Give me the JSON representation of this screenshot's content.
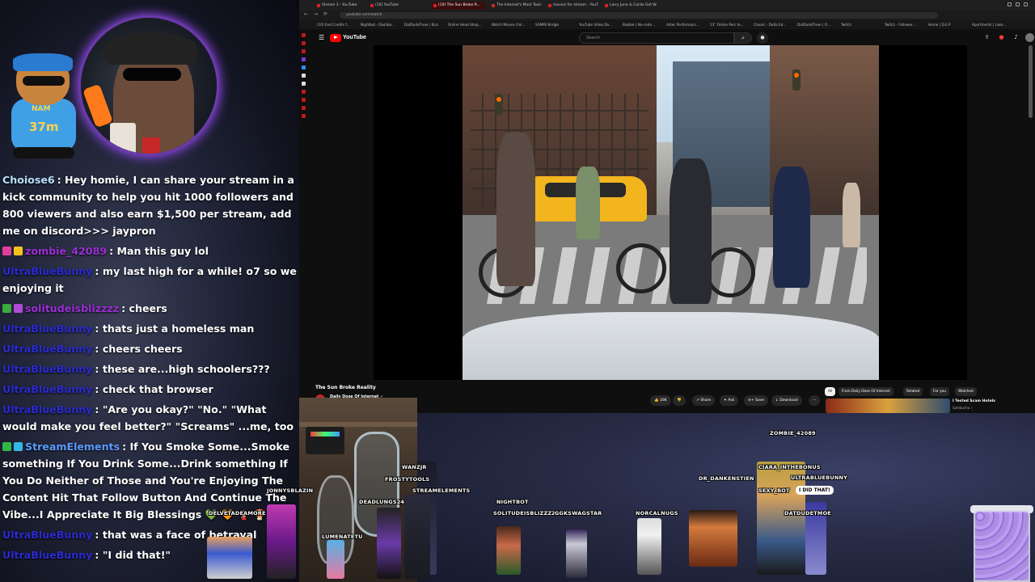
{
  "webcam": {
    "timer": "37m",
    "shirt_text": "NAM"
  },
  "chat": [
    {
      "user": "Choiose6",
      "color": "#b7e0ff",
      "badges": [],
      "text": ": Hey homie, I can share your stream in a kick community to help you hit 1000 followers and 800 viewers and also earn $1,500 per stream, add me on discord>>> jaypron"
    },
    {
      "user": "zombie_42089",
      "color": "#9b2fd6",
      "badges": [
        "#e0409c",
        "#f7c21a"
      ],
      "text": ": Man this guy lol"
    },
    {
      "user": "UltraBlueBunny",
      "color": "#2a2ad0",
      "badges": [],
      "text": ": my last high for a while! o7 so we enjoying it"
    },
    {
      "user": "solitudeisblizzzz",
      "color": "#9b2fd6",
      "badges": [
        "#3caa3c",
        "#b04ad6"
      ],
      "text": ": cheers"
    },
    {
      "user": "UltraBlueBunny",
      "color": "#2a2ad0",
      "badges": [],
      "text": ": thats just a homeless man"
    },
    {
      "user": "UltraBlueBunny",
      "color": "#2a2ad0",
      "badges": [],
      "text": ": cheers cheers"
    },
    {
      "user": "UltraBlueBunny",
      "color": "#2a2ad0",
      "badges": [],
      "text": ": these are...high schoolers???"
    },
    {
      "user": "UltraBlueBunny",
      "color": "#2a2ad0",
      "badges": [],
      "text": ": check that browser"
    },
    {
      "user": "UltraBlueBunny",
      "color": "#2a2ad0",
      "badges": [],
      "text": ": \"Are you okay?\" \"No.\" \"What would make you feel better?\" \"Screams\" ...me, too"
    },
    {
      "user": "StreamElements",
      "color": "#5b9bff",
      "badges": [
        "#2fb84a",
        "#33b7e6"
      ],
      "text": ": If You Smoke Some...Smoke something If You Drink Some...Drink something If You Do Neither of Those and You're Enjoying The Content Hit That Follow Button And Continue The Vibe...I Appreciate It Big Blessings 💚 🧡 🧯 🍄"
    },
    {
      "user": "UltraBlueBunny",
      "color": "#2a2ad0",
      "badges": [],
      "text": ": that was a face of betrayal"
    },
    {
      "user": "UltraBlueBunny",
      "color": "#2a2ad0",
      "badges": [],
      "text": ": \"I did that!\""
    }
  ],
  "browser": {
    "tabs": [
      {
        "label": "Stream 3 - YouTube",
        "active": false
      },
      {
        "label": "(10) YouTube",
        "active": false
      },
      {
        "label": "(10) The Sun Broke R...",
        "active": true
      },
      {
        "label": "The Internet's Most Toxic...",
        "active": false
      },
      {
        "label": "movies for stream - YouT...",
        "active": false
      },
      {
        "label": "Larry June & Cardo Got W...",
        "active": false
      }
    ],
    "url": "youtube.com/watch",
    "bookmarks": [
      "(10) End Credits f...",
      "Nightbot - Dashbo...",
      "DatDudeTrxxe | Kics",
      "Online Head Shop...",
      "Watch Movies Onl...",
      "SAMMI Bridge",
      "YouTube Video Do...",
      "Bubble | No-code...",
      "Aztec Performanc...",
      "13\" Online Perc to...",
      "Classic - Delta Ed...",
      "DatDudeTrxxe | Fl...",
      "Twitch",
      "Twitch - Follower...",
      "Home | D.E.P",
      "Apartments | Lake..."
    ],
    "search_placeholder": "Search",
    "logo_text": "YouTube"
  },
  "video": {
    "watermark": "jaimeamoure",
    "title": "The Sun Broke Reality",
    "channel": "Daily Dose Of Internet ✓",
    "actions": [
      "👍 16K",
      "👎",
      "↗ Share",
      "✦ Ask",
      "≡+ Save",
      "↓ Download",
      "···"
    ],
    "chips": [
      "All",
      "From Daily Dose Of Internet",
      "Related",
      "For you",
      "Watched"
    ],
    "rec_title": "I Tested Scam Hotels",
    "rec_channel": "Sambucha ✓"
  },
  "avatars": {
    "names": [
      {
        "label": "ZOMBIE_42089"
      },
      {
        "label": "CIARA_INTHEBONUS"
      },
      {
        "label": "ULTRABLUEBUNNY"
      },
      {
        "label": "DR_DANKENSTIEN"
      },
      {
        "label": "SEXY_BOT"
      },
      {
        "label": "DATDUDETMOE"
      },
      {
        "label": "NIGHTBOT"
      },
      {
        "label": "SOLITUDEISBLIZZZZ"
      },
      {
        "label": "GGKSWAGSTAR"
      },
      {
        "label": "NORCALNUGS"
      },
      {
        "label": "WANZJR"
      },
      {
        "label": "FROSTYTOOLS"
      },
      {
        "label": "STREAMELEMENTS"
      },
      {
        "label": "JONNYSBLAZIN"
      },
      {
        "label": "DEADLUNGS2420"
      },
      {
        "label": "DELVETADEAMORE"
      },
      {
        "label": "LUMENATETU"
      }
    ],
    "speech": "I DID THAT!"
  }
}
